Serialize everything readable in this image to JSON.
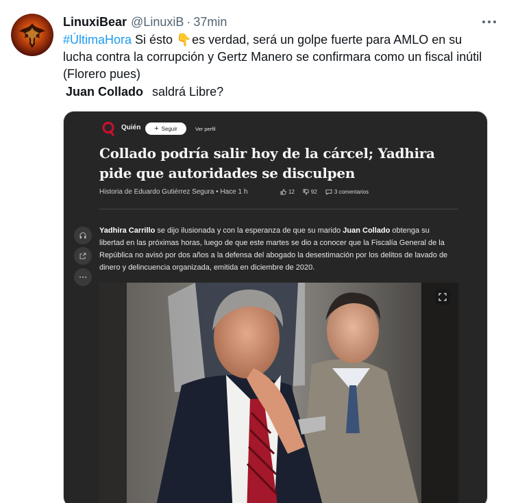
{
  "tweet": {
    "display_name": "LinuxiBear",
    "handle": "@LinuxiB",
    "separator": "·",
    "time": "37min",
    "hashtag": "#ÚltimaHora",
    "text_a": " Si ésto ",
    "emoji": "👇",
    "text_b": " es verdad, será un golpe fuerte para AMLO en su lucha contra la corrupción y Gertz Manero se confirmara como un fiscal inútil (Florero pues)",
    "name_bold": "Juan Collado",
    "text_c": "saldrá Libre?"
  },
  "card": {
    "brand": "Quién",
    "follow_label": "Seguir",
    "follow_plus": "+",
    "profile_label": "Ver perfil",
    "headline": "Collado podría salir hoy de la cárcel; Yadhira pide que autoridades se disculpen",
    "byline": "Historia de Eduardo Gutiérrez Segura • Hace 1 h",
    "likes": "12",
    "dislikes": "92",
    "comments": "3 comentarios",
    "body": {
      "name1": "Yadhira Carrillo",
      "part1": " se dijo ilusionada y con la esperanza de que su marido ",
      "name2": "Juan Collado",
      "part2": " obtenga su libertad en las próximas horas, luego de que este martes se dio a conocer que la Fiscalía General de la República no avisó por dos años a la defensa del abogado la desestimación por los delitos de lavado de dinero y delincuencia organizada, emitida en diciembre de 2020."
    },
    "colors": {
      "background": "#262626",
      "brand_red": "#c8102e",
      "text": "#e8e8e8"
    }
  },
  "colors": {
    "link": "#1d9bf0",
    "muted": "#536471"
  }
}
